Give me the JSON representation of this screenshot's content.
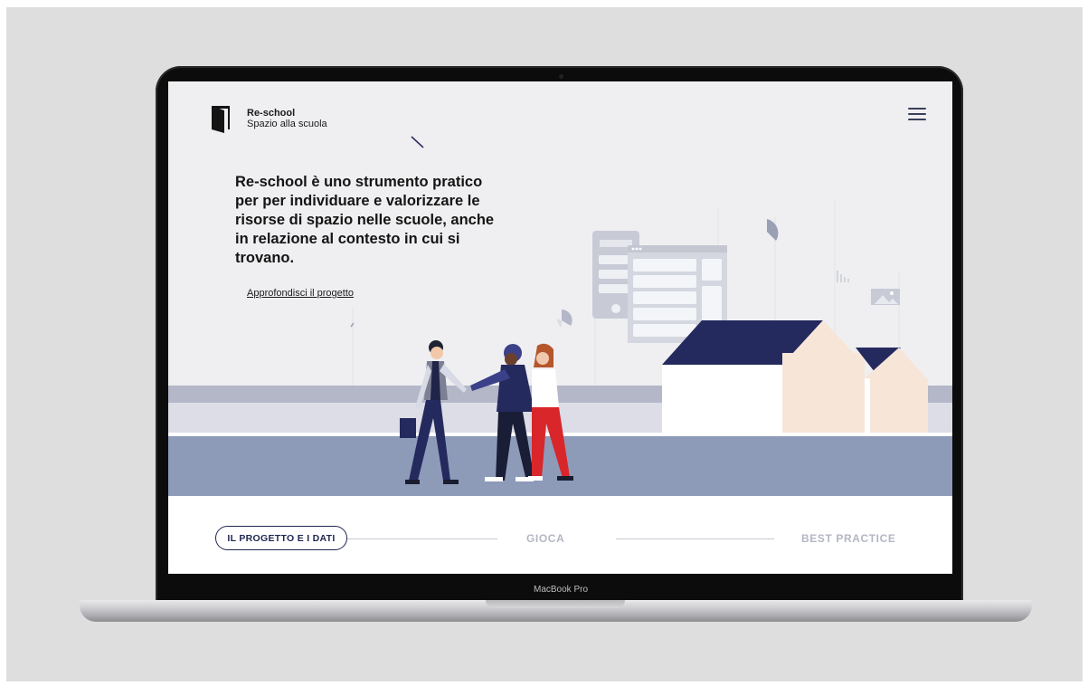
{
  "brand": {
    "name": "Re-school",
    "tagline": "Spazio alla scuola"
  },
  "hero": {
    "headline": "Re-school è uno strumento pratico per per individuare e valorizzare le risorse di spazio nelle scuole, anche in relazione al contesto in cui si trovano.",
    "link_label": "Approfondisci il progetto"
  },
  "nav": {
    "items": [
      {
        "label": "IL PROGETTO E I DATI",
        "active": true
      },
      {
        "label": "GIOCA",
        "active": false
      },
      {
        "label": "BEST PRACTICE",
        "active": false
      }
    ]
  },
  "device": {
    "label": "MacBook Pro"
  },
  "colors": {
    "navy": "#252a5e",
    "street": "#8d9bb9",
    "house_wall": "#ffffff",
    "house_side": "#f7e6d8",
    "accent_red": "#d8262b",
    "nav_text_active": "#1e2650",
    "nav_text_inactive": "#b4b7c3"
  },
  "icons": [
    "door-logo-icon",
    "hamburger-menu-icon"
  ]
}
